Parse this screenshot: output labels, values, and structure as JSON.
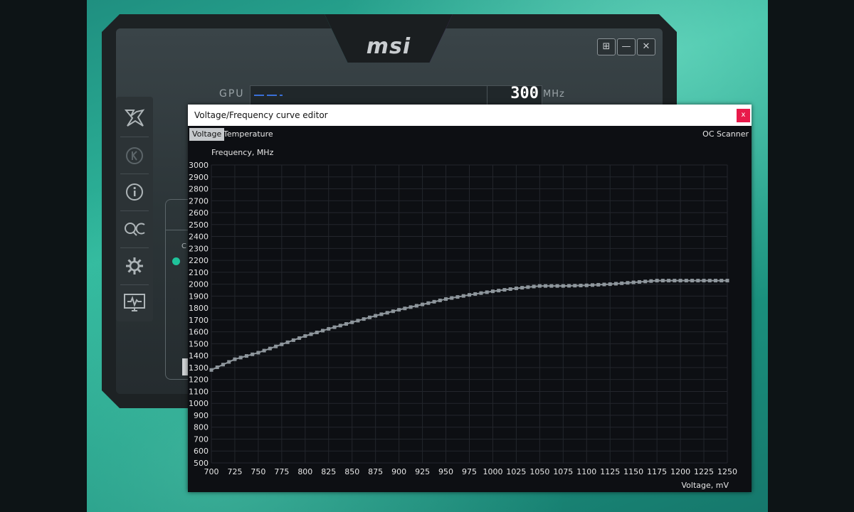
{
  "afterburner": {
    "logo": "msi",
    "window_controls": [
      "⊞",
      "—",
      "✕"
    ],
    "gpu": {
      "label": "GPU",
      "value": "300",
      "unit": "MHz"
    },
    "sidebar_items": [
      "kombustor",
      "k-boost",
      "info",
      "oc-scanner",
      "settings",
      "hardware-monitor"
    ],
    "panel_text": "C",
    "accent_color": "#1fc29a"
  },
  "vf_editor": {
    "title": "Voltage/Frequency curve editor",
    "close_label": "x",
    "tabs": [
      "Voltage",
      "Temperature"
    ],
    "active_tab": "Voltage",
    "oc_scanner_label": "OC Scanner",
    "close_color": "#e81a4a"
  },
  "chart_data": {
    "type": "line",
    "ylabel": "Frequency, MHz",
    "xlabel": "Voltage, mV",
    "xlim": [
      700,
      1250
    ],
    "ylim": [
      500,
      3000
    ],
    "x_ticks": [
      700,
      725,
      750,
      775,
      800,
      825,
      850,
      875,
      900,
      925,
      950,
      975,
      1000,
      1025,
      1050,
      1075,
      1100,
      1125,
      1150,
      1175,
      1200,
      1225,
      1250
    ],
    "y_ticks": [
      3000,
      2900,
      2800,
      2700,
      2600,
      2500,
      2400,
      2300,
      2200,
      2100,
      2000,
      1900,
      1800,
      1700,
      1600,
      1500,
      1400,
      1300,
      1200,
      1100,
      1000,
      900,
      800,
      700,
      600,
      500
    ],
    "grid": true,
    "line_color": "#8e969c",
    "series": [
      {
        "x": [
          700,
          725,
          750,
          775,
          800,
          825,
          850,
          875,
          900,
          925,
          950,
          975,
          1000,
          1025,
          1050,
          1075,
          1100,
          1125,
          1150,
          1175,
          1200,
          1225,
          1250
        ],
        "values": [
          1280,
          1370,
          1425,
          1495,
          1565,
          1625,
          1680,
          1735,
          1785,
          1830,
          1875,
          1910,
          1940,
          1965,
          1985,
          1985,
          1990,
          2000,
          2015,
          2030,
          2030,
          2030,
          2030
        ]
      }
    ]
  }
}
